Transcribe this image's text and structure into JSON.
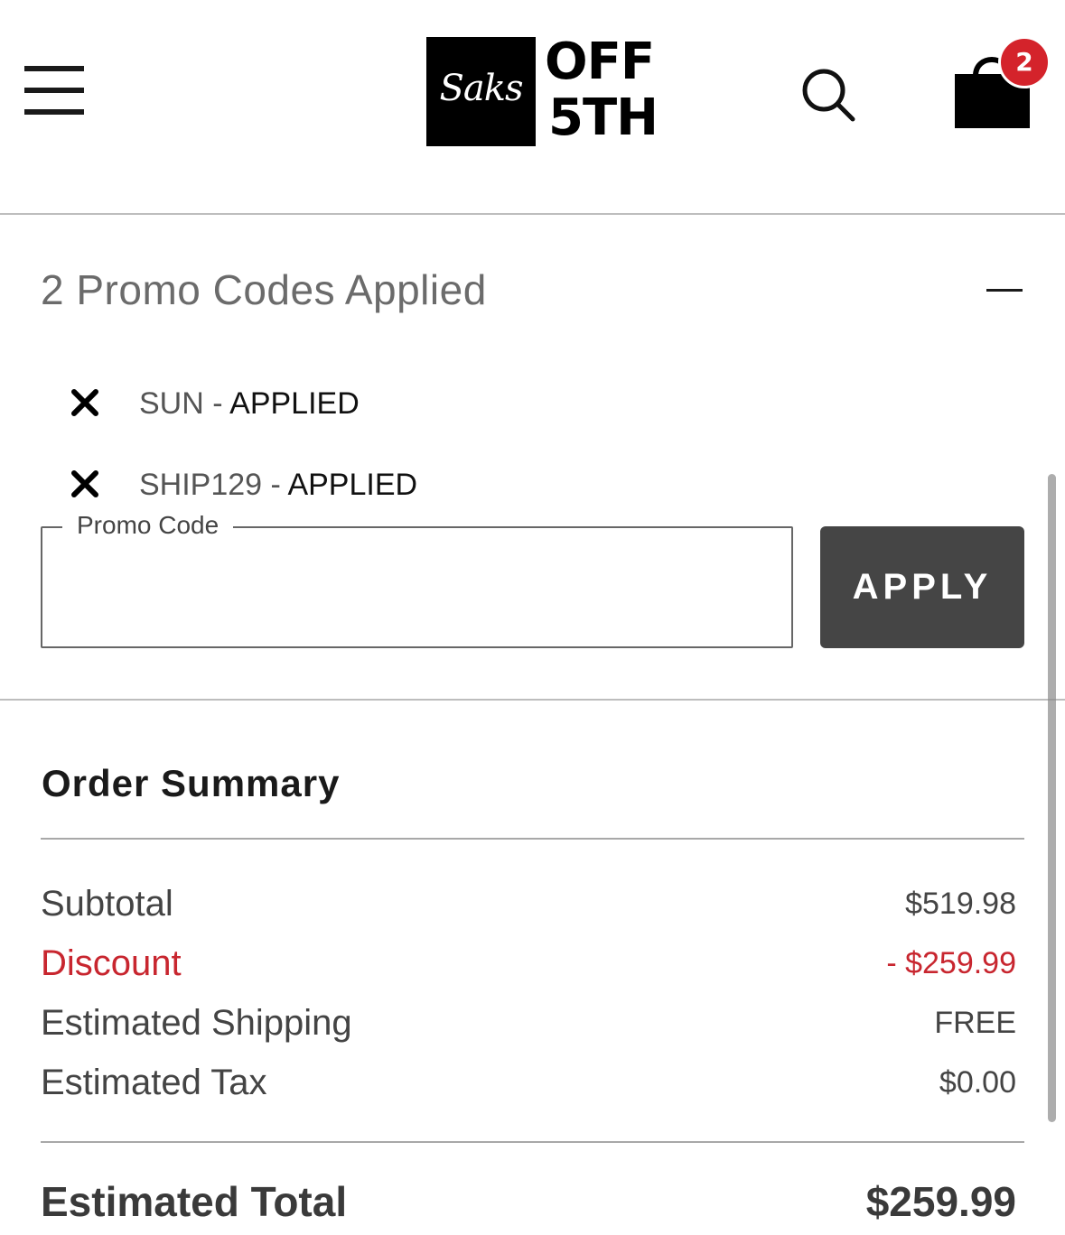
{
  "header": {
    "logo": {
      "script": "Saks",
      "line1": "OFF",
      "line2": "5TH"
    },
    "cart_count": "2"
  },
  "promo": {
    "title": "2 Promo Codes Applied",
    "codes": [
      {
        "code": "SUN",
        "separator": " - ",
        "status": "APPLIED"
      },
      {
        "code": "SHIP129",
        "separator": " - ",
        "status": "APPLIED"
      }
    ],
    "field_label": "Promo Code",
    "field_value": "",
    "apply_label": "APPLY"
  },
  "summary": {
    "title": "Order Summary",
    "rows": [
      {
        "label": "Subtotal",
        "value": "$519.98"
      },
      {
        "label": "Discount",
        "value": "- $259.99"
      },
      {
        "label": "Estimated Shipping",
        "value": "FREE"
      },
      {
        "label": "Estimated Tax",
        "value": "$0.00"
      }
    ],
    "total_label": "Estimated Total",
    "total_value": "$259.99"
  },
  "colors": {
    "discount": "#c8262f",
    "badge": "#d4232b",
    "apply_button": "#454545"
  }
}
